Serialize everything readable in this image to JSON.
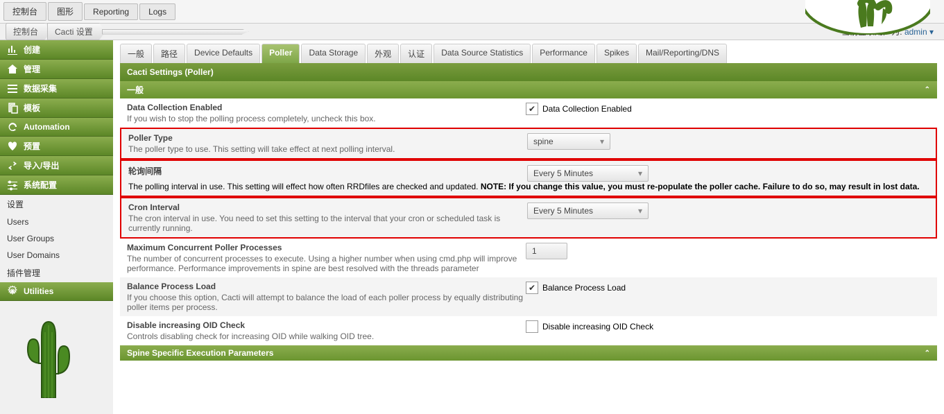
{
  "topTabs": [
    "控制台",
    "图形",
    "Reporting",
    "Logs"
  ],
  "breadcrumb": [
    "控制台",
    "Cacti 设置"
  ],
  "user": {
    "prefix": "当前登录用户为:",
    "name": "admin",
    "caret": "▾"
  },
  "sidebar": {
    "main": [
      {
        "icon": "chart",
        "label": "创建"
      },
      {
        "icon": "home",
        "label": "管理"
      },
      {
        "icon": "bars",
        "label": "数据采集"
      },
      {
        "icon": "copy",
        "label": "模板"
      },
      {
        "icon": "refresh",
        "label": "Automation"
      },
      {
        "icon": "heart",
        "label": "预置"
      },
      {
        "icon": "exchange",
        "label": "导入/导出"
      },
      {
        "icon": "sliders",
        "label": "系统配置"
      }
    ],
    "sub": [
      "设置",
      "Users",
      "User Groups",
      "User Domains",
      "插件管理"
    ],
    "utilities": {
      "icon": "gear",
      "label": "Utilities"
    }
  },
  "subTabs": [
    "一般",
    "路径",
    "Device Defaults",
    "Poller",
    "Data Storage",
    "外观",
    "认证",
    "Data Source Statistics",
    "Performance",
    "Spikes",
    "Mail/Reporting/DNS"
  ],
  "subTabActive": 3,
  "panelTitle": "Cacti Settings (Poller)",
  "sectionHeaders": {
    "general": "一般",
    "spine": "Spine Specific Execution Parameters"
  },
  "rows": {
    "dataCollection": {
      "label": "Data Collection Enabled",
      "desc": "If you wish to stop the polling process completely, uncheck this box.",
      "chkLabel": "Data Collection Enabled",
      "checked": true
    },
    "pollerType": {
      "label": "Poller Type",
      "desc": "The poller type to use. This setting will take effect at next polling interval.",
      "value": "spine"
    },
    "pollInterval": {
      "label": "轮询间隔",
      "desc1": "The polling interval in use. This setting will effect how often RRDfiles are checked and updated. ",
      "descNote": "NOTE: If you change this value, you must re-populate the poller cache. Failure to do so, may result in lost data.",
      "value": "Every 5 Minutes"
    },
    "cronInterval": {
      "label": "Cron Interval",
      "desc": "The cron interval in use. You need to set this setting to the interval that your cron or scheduled task is currently running.",
      "value": "Every 5 Minutes"
    },
    "maxProc": {
      "label": "Maximum Concurrent Poller Processes",
      "desc": "The number of concurrent processes to execute. Using a higher number when using cmd.php will improve performance. Performance improvements in spine are best resolved with the threads parameter",
      "value": "1"
    },
    "balance": {
      "label": "Balance Process Load",
      "desc": "If you choose this option, Cacti will attempt to balance the load of each poller process by equally distributing poller items per process.",
      "chkLabel": "Balance Process Load",
      "checked": true
    },
    "disableOid": {
      "label": "Disable increasing OID Check",
      "desc": "Controls disabling check for increasing OID while walking OID tree.",
      "chkLabel": "Disable increasing OID Check",
      "checked": false
    }
  }
}
